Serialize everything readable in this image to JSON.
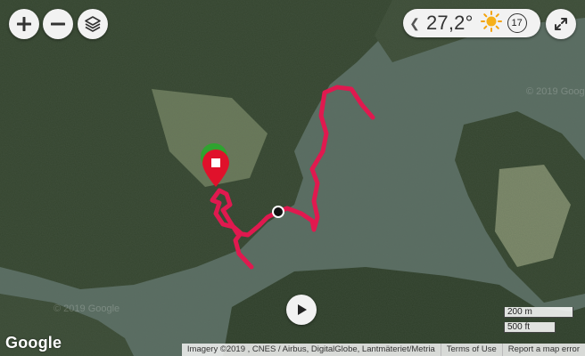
{
  "map": {
    "type": "satellite",
    "route_color": "#e0194f",
    "watermark": "© 2019 Google"
  },
  "controls": {
    "zoom_in": "zoom-in",
    "zoom_out": "zoom-out",
    "layers": "layers",
    "fullscreen": "fullscreen"
  },
  "weather": {
    "temperature": "27,2°",
    "icon": "sun-icon",
    "hour": "17"
  },
  "markers": {
    "end": "stop-marker",
    "start": "start-marker",
    "current": "position-dot"
  },
  "playback": {
    "icon": "play-icon"
  },
  "scale": {
    "metric": "200 m",
    "imperial": "500 ft"
  },
  "footer": {
    "logo": "Google",
    "imagery": "Imagery ©2019 , CNES / Airbus, DigitalGlobe, Lantmäteriet/Metria",
    "terms": "Terms of Use",
    "report": "Report a map error"
  }
}
